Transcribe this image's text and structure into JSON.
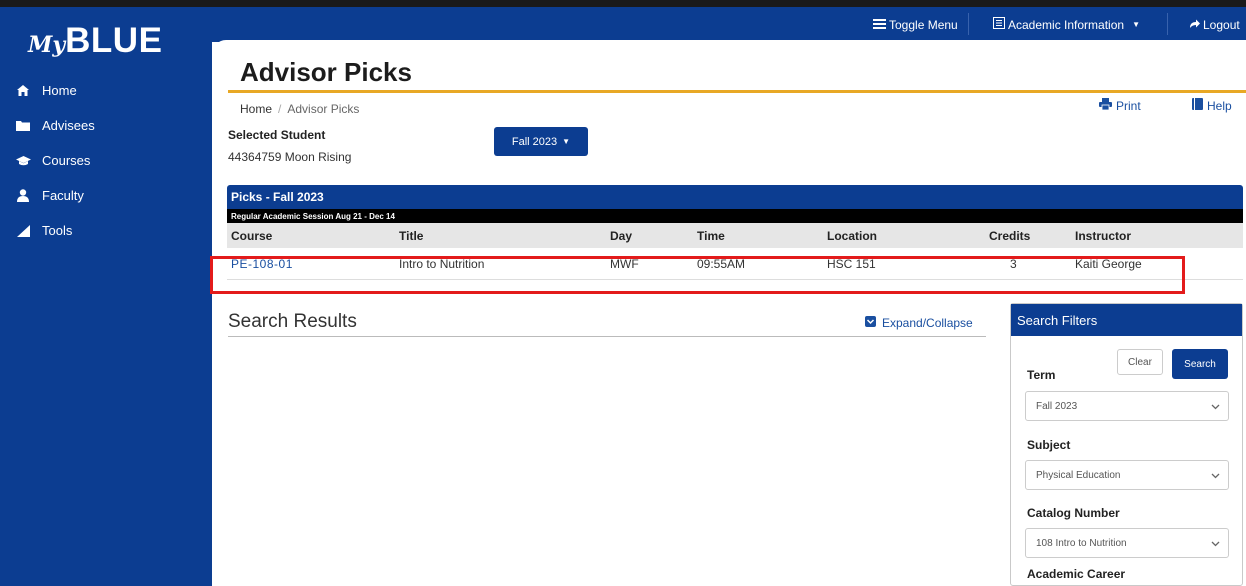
{
  "brand": {
    "my": "My",
    "name": "BLUE"
  },
  "sidebar": {
    "items": [
      {
        "label": "Home",
        "icon": "home-icon"
      },
      {
        "label": "Advisees",
        "icon": "folder-icon"
      },
      {
        "label": "Courses",
        "icon": "graduation-cap-icon"
      },
      {
        "label": "Faculty",
        "icon": "user-icon"
      },
      {
        "label": "Tools",
        "icon": "chart-icon"
      }
    ]
  },
  "topbar": {
    "toggle_menu": "Toggle Menu",
    "academic_info": "Academic Information",
    "logout": "Logout"
  },
  "page": {
    "title": "Advisor Picks",
    "breadcrumb": {
      "home": "Home",
      "current": "Advisor Picks"
    },
    "print": "Print",
    "help": "Help"
  },
  "student": {
    "label": "Selected Student",
    "value": "44364759 Moon  Rising",
    "term_button": "Fall 2023"
  },
  "picks": {
    "title": "Picks - Fall 2023",
    "session": "Regular Academic Session  Aug 21 - Dec 14",
    "columns": [
      "Course",
      "Title",
      "Day",
      "Time",
      "Location",
      "Credits",
      "Instructor"
    ],
    "rows": [
      {
        "course": "PE-108-01",
        "title": "Intro to Nutrition",
        "day": "MWF",
        "time": "09:55AM",
        "location": "HSC 151",
        "credits": "3",
        "instructor": "Kaiti George"
      }
    ]
  },
  "search_results": {
    "title": "Search Results",
    "expand": "Expand/Collapse"
  },
  "filters": {
    "title": "Search Filters",
    "clear": "Clear",
    "search": "Search",
    "term_label": "Term",
    "term_value": "Fall 2023",
    "subject_label": "Subject",
    "subject_value": "Physical Education",
    "catalog_label": "Catalog Number",
    "catalog_value": "108 Intro to Nutrition",
    "career_label": "Academic Career"
  },
  "colors": {
    "primary": "#0c3d91",
    "accent": "#e8a825",
    "highlight": "#e31b1b"
  }
}
